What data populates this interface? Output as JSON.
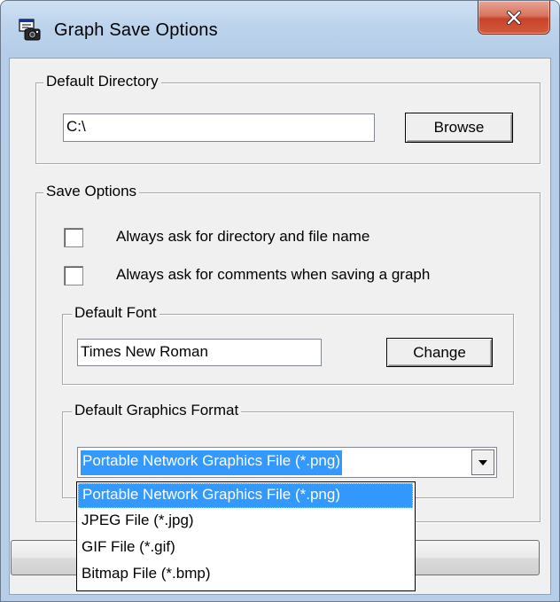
{
  "window": {
    "title": "Graph Save Options"
  },
  "default_directory": {
    "group_label": "Default Directory",
    "path_value": "C:\\",
    "browse_label": "Browse"
  },
  "save_options": {
    "group_label": "Save Options",
    "checkboxes": [
      {
        "label": "Always ask for directory and file name",
        "checked": false
      },
      {
        "label": "Always ask for comments when saving a graph",
        "checked": false
      }
    ],
    "default_font": {
      "group_label": "Default Font",
      "font_value": "Times New Roman",
      "change_label": "Change"
    },
    "graphics_format": {
      "group_label": "Default Graphics Format",
      "selected_value": "Portable Network Graphics File (*.png)",
      "options": [
        "Portable Network Graphics File (*.png)",
        "JPEG File (*.jpg)",
        "GIF File (*.gif)",
        "Bitmap File (*.bmp)"
      ]
    }
  },
  "colors": {
    "selection": "#3399ff",
    "close_button": "#c7432a",
    "dialog_background": "#f0f0f0"
  }
}
